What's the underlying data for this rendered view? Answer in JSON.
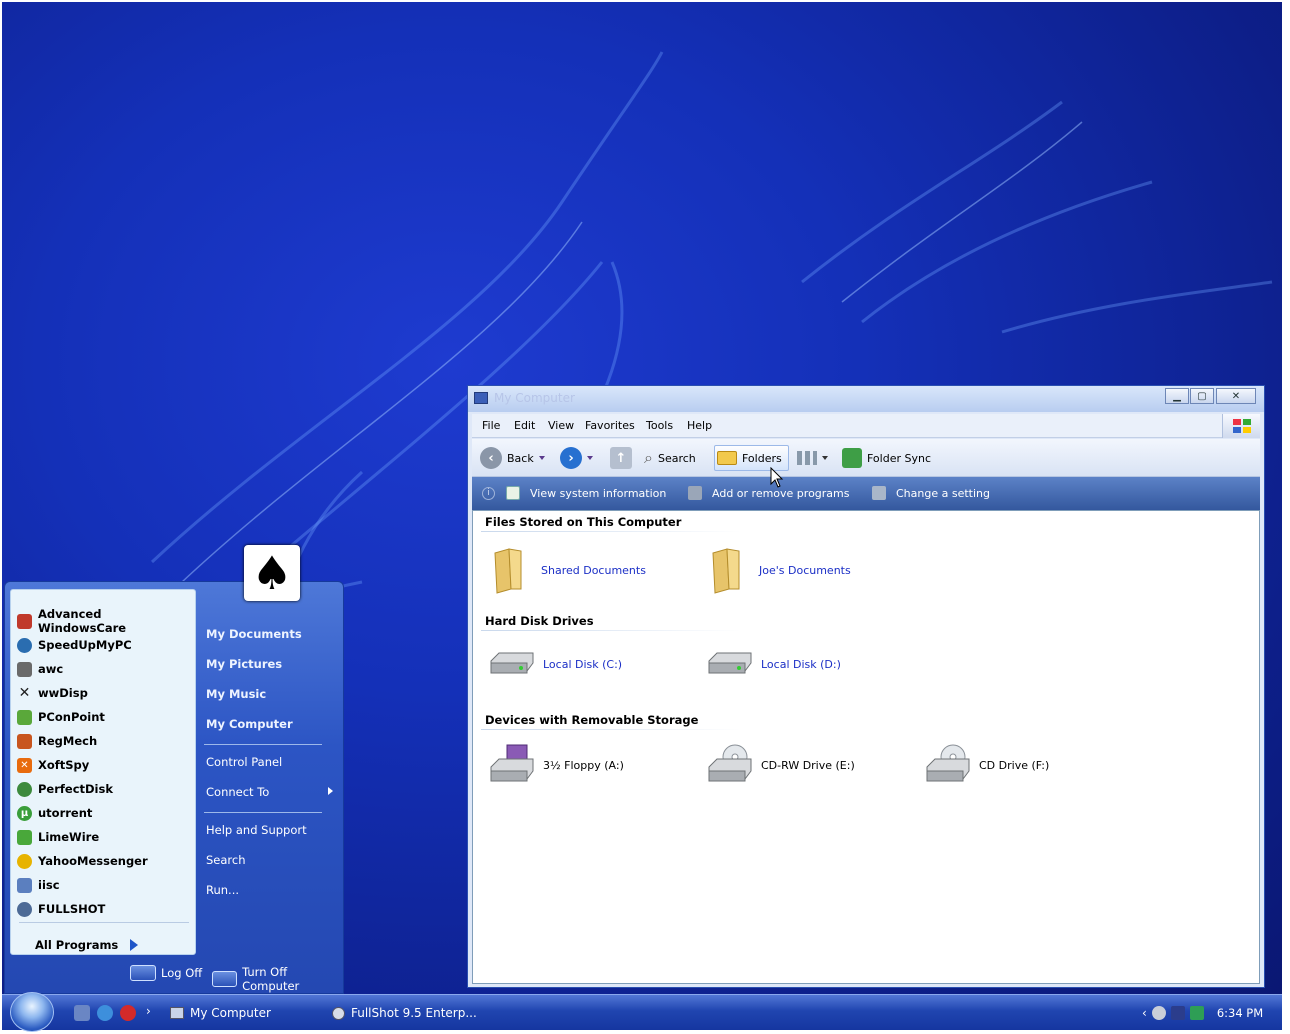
{
  "start_menu": {
    "pinned": [
      {
        "label": "Advanced WindowsCare",
        "icon": "advanced-windowscare-icon",
        "color": "#c0392b"
      },
      {
        "label": "SpeedUpMyPC",
        "icon": "speedupmypc-icon",
        "color": "#2a6db0"
      },
      {
        "label": "awc",
        "icon": "awc-icon",
        "color": "#6a6a6a"
      },
      {
        "label": "wwDisp",
        "icon": "wwdisp-icon",
        "color": "#222222"
      },
      {
        "label": "PConPoint",
        "icon": "pconpoint-icon",
        "color": "#5aa83a"
      },
      {
        "label": "RegMech",
        "icon": "regmech-icon",
        "color": "#c8551e"
      },
      {
        "label": "XoftSpy",
        "icon": "xoftspy-icon",
        "color": "#e86b0e"
      },
      {
        "label": "PerfectDisk",
        "icon": "perfectdisk-icon",
        "color": "#3d8a3d"
      },
      {
        "label": "utorrent",
        "icon": "utorrent-icon",
        "color": "#3a9e3a"
      },
      {
        "label": "LimeWire",
        "icon": "limewire-icon",
        "color": "#49a83a"
      },
      {
        "label": "YahooMessenger",
        "icon": "yahoomessenger-icon",
        "color": "#e7b300"
      },
      {
        "label": "iisc",
        "icon": "iisc-icon",
        "color": "#5b7fbf"
      },
      {
        "label": "FULLSHOT",
        "icon": "fullshot-icon",
        "color": "#4c6a96"
      }
    ],
    "all_programs": "All Programs",
    "right_bold": [
      "My Documents",
      "My Pictures",
      "My Music",
      "My Computer"
    ],
    "right_group1": [
      "Control Panel",
      "Connect To"
    ],
    "right_group2": [
      "Help and Support",
      "Search",
      "Run..."
    ],
    "log_off": "Log Off",
    "turn_off": "Turn Off Computer",
    "avatar_glyph": "♠"
  },
  "window": {
    "title": "My Computer",
    "menu": [
      "File",
      "Edit",
      "View",
      "Favorites",
      "Tools",
      "Help"
    ],
    "toolbar": {
      "back": "Back",
      "search": "Search",
      "folders": "Folders",
      "folder_sync": "Folder Sync"
    },
    "tasks": [
      "View system information",
      "Add or remove programs",
      "Change a setting"
    ],
    "groups": [
      {
        "title": "Files Stored on This Computer",
        "items": [
          {
            "label": "Shared Documents",
            "icon": "folder-icon"
          },
          {
            "label": "Joe's Documents",
            "icon": "folder-icon"
          }
        ]
      },
      {
        "title": "Hard Disk Drives",
        "items": [
          {
            "label": "Local Disk (C:)",
            "icon": "hard-disk-icon"
          },
          {
            "label": "Local Disk (D:)",
            "icon": "hard-disk-icon"
          }
        ]
      },
      {
        "title": "Devices with Removable Storage",
        "items": [
          {
            "label": "3½ Floppy (A:)",
            "icon": "floppy-drive-icon"
          },
          {
            "label": "CD-RW Drive (E:)",
            "icon": "cd-drive-icon"
          },
          {
            "label": "CD Drive (F:)",
            "icon": "cd-drive-icon"
          }
        ]
      }
    ]
  },
  "taskbar": {
    "tasks": [
      "My Computer",
      "FullShot 9.5 Enterp..."
    ],
    "clock": "6:34 PM"
  }
}
